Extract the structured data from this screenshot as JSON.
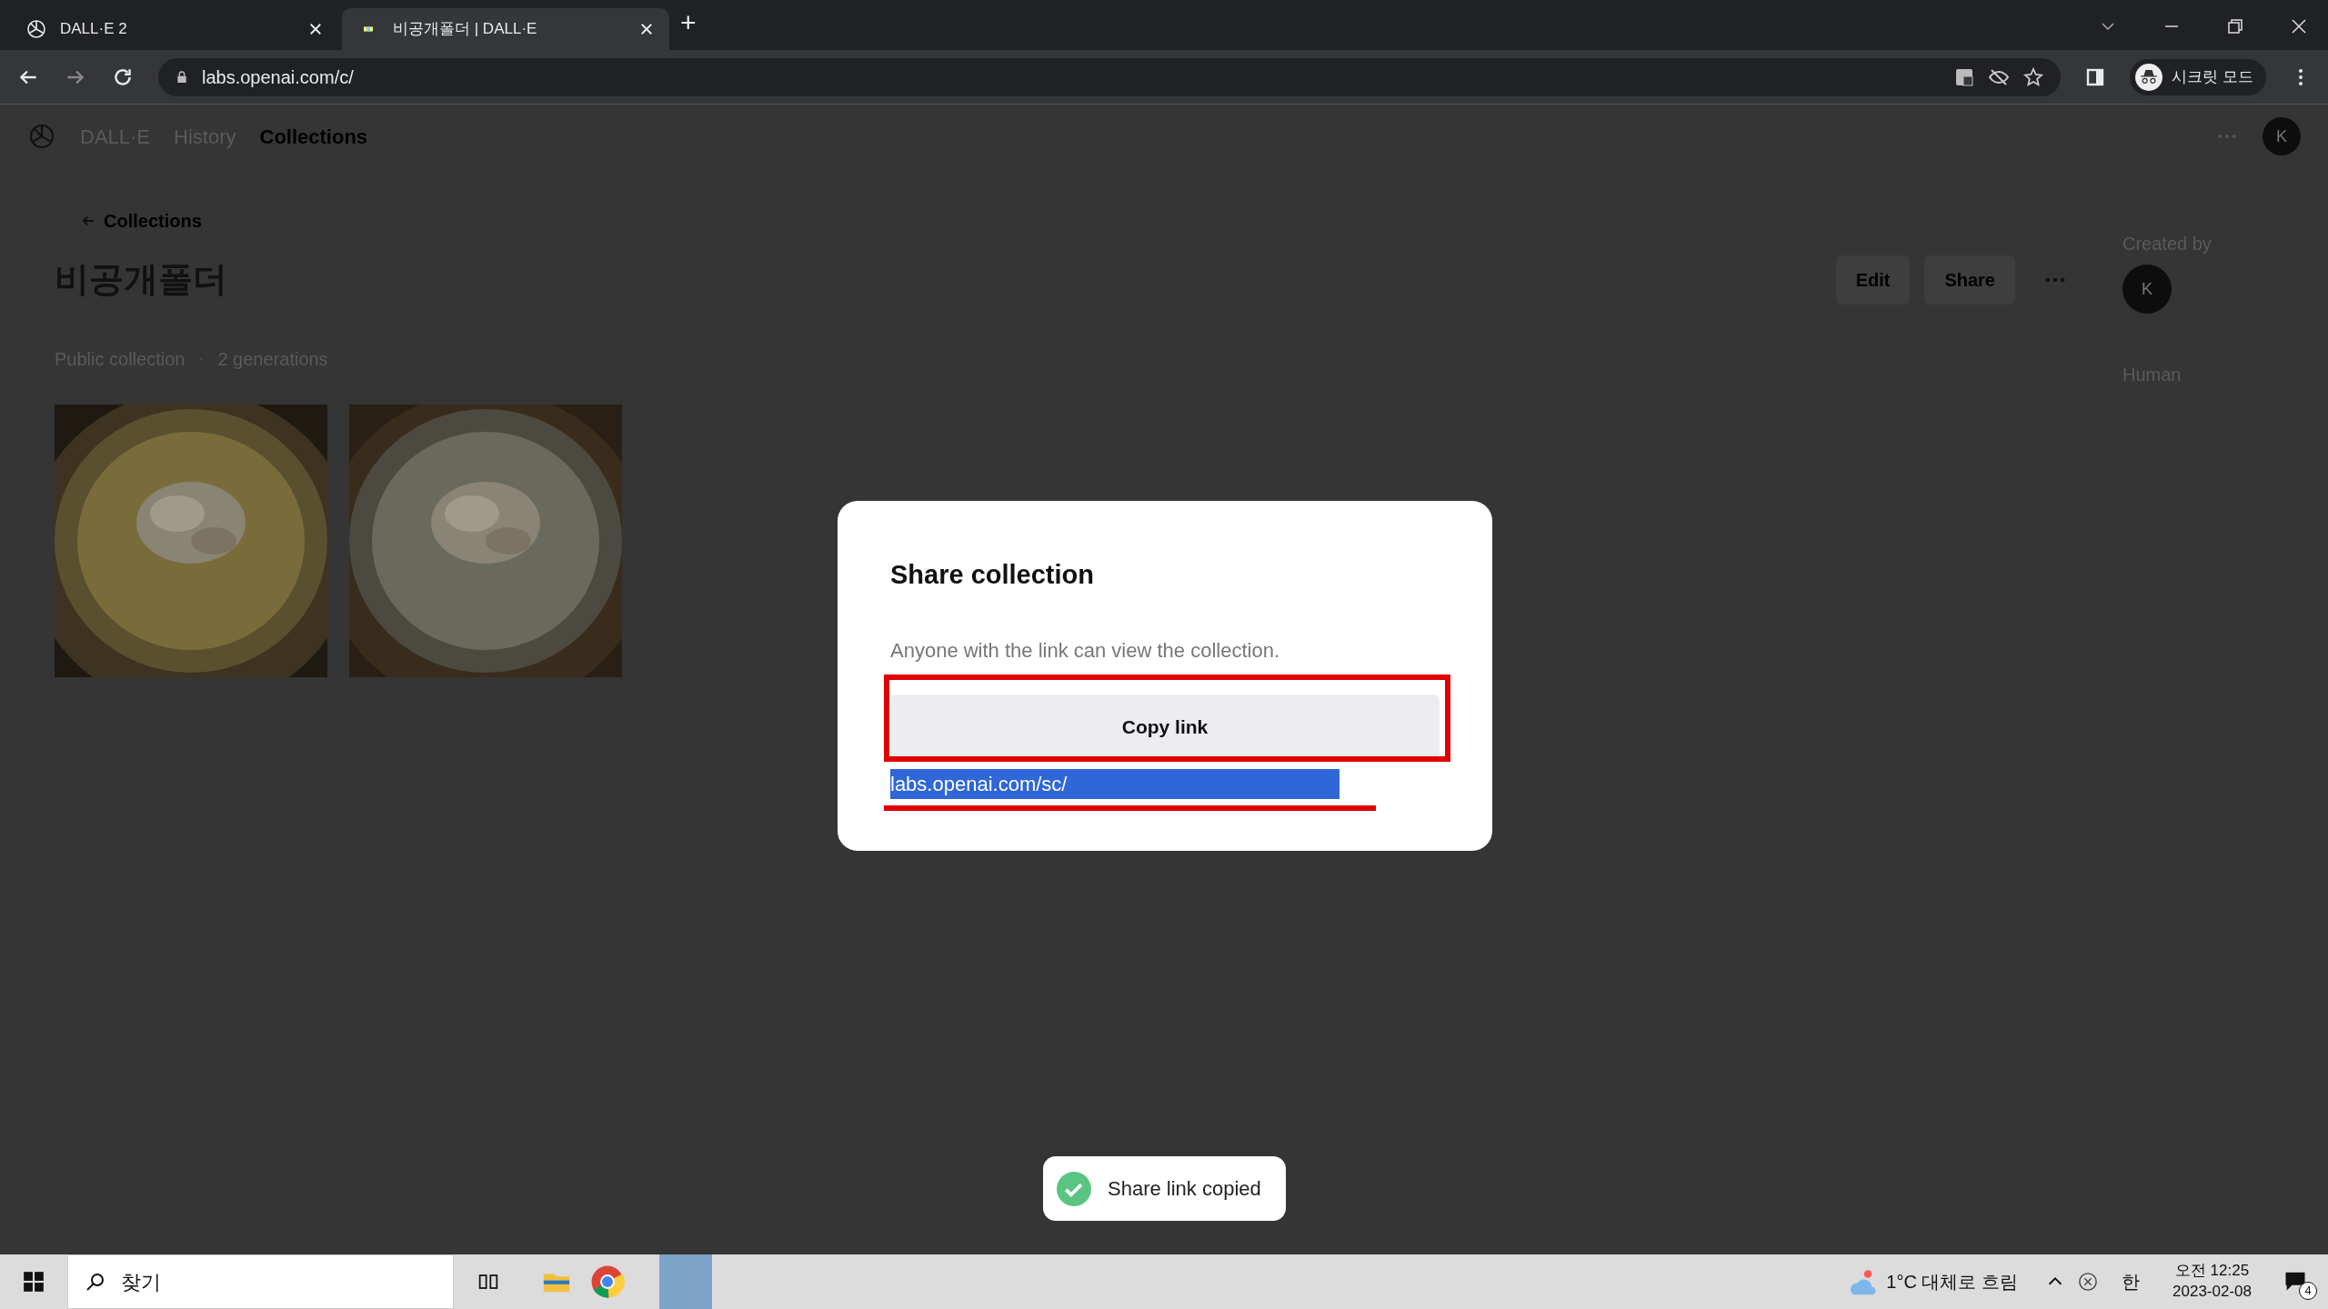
{
  "browser": {
    "tabs": [
      {
        "title": "DALL·E 2",
        "selected": false
      },
      {
        "title": "비공개폴더 | DALL·E",
        "selected": true
      }
    ],
    "new_tab": "+",
    "address": "labs.openai.com/c/",
    "profile": "시크릿 모드"
  },
  "site_nav": {
    "brand": "DALL·E",
    "items": [
      {
        "label": "History",
        "selected": false
      },
      {
        "label": "Collections",
        "selected": true
      }
    ],
    "avatar": "K"
  },
  "collection": {
    "back": "Collections",
    "title": "비공개폴더",
    "actions": [
      "Edit",
      "Share"
    ],
    "meta": [
      "Public collection",
      "2 generations"
    ],
    "created_by_label": "Created by",
    "creator_avatar": "K",
    "creator_kind": "Human"
  },
  "dialog": {
    "title": "Share collection",
    "text": "Anyone with the link can view the collection.",
    "button": "Copy link",
    "link": "labs.openai.com/sc/",
    "link_selected": true
  },
  "toast": {
    "text": "Share link copied"
  },
  "taskbar": {
    "search_placeholder": "찾기",
    "weather": "1°C 대체로 흐림",
    "ime": "한",
    "time": "오전 12:25",
    "date": "2023-02-08",
    "notifications": "4"
  }
}
